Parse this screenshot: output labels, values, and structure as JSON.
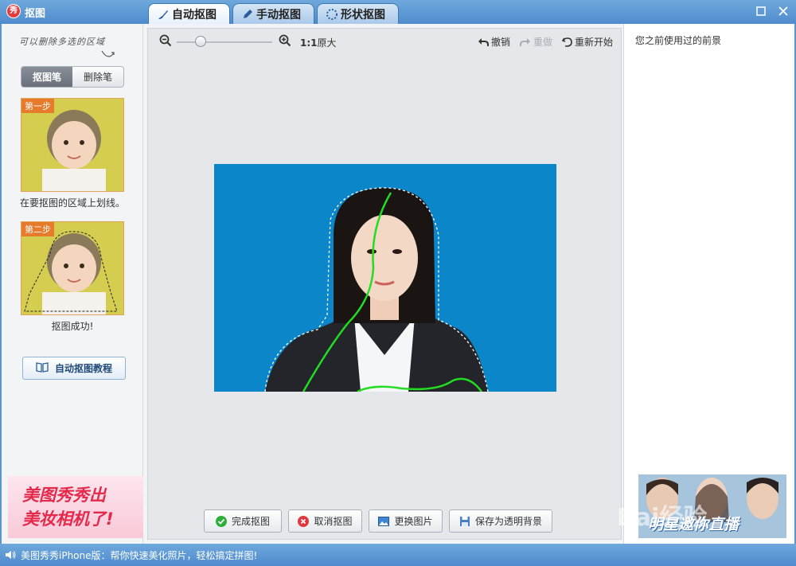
{
  "app": {
    "logo_text": "秀",
    "title": "抠图"
  },
  "tabs": [
    {
      "label": "自动抠图",
      "active": true
    },
    {
      "label": "手动抠图",
      "active": false
    },
    {
      "label": "形状抠图",
      "active": false
    }
  ],
  "left_panel": {
    "hint_text": "可以删除多选的区域",
    "tools": {
      "pen_label": "抠图笔",
      "eraser_label": "删除笔"
    },
    "step1": {
      "tag": "第一步",
      "caption": "在要抠图的区域上划线。"
    },
    "step2": {
      "tag": "第二步",
      "caption": "抠图成功!"
    },
    "tutorial_label": "自动抠图教程",
    "ad": {
      "line1": "美图秀秀出",
      "line2": "美妆相机了!"
    }
  },
  "toolbar": {
    "zoom_level": 0.25,
    "ratio_bold": "1:1",
    "ratio_label": "原大",
    "undo_label": "撤销",
    "redo_label": "重做",
    "restart_label": "重新开始"
  },
  "actions": {
    "finish_label": "完成抠图",
    "cancel_label": "取消抠图",
    "change_label": "更换图片",
    "save_label": "保存为透明背景"
  },
  "right_panel": {
    "title": "您之前使用过的前景",
    "ad_text": "明星邀你直播"
  },
  "statusbar": {
    "text": "美图秀秀iPhone版：帮你快速美化照片，轻松搞定拼图!"
  },
  "watermark": "Bai经验",
  "colors": {
    "titlebar": "#5b95cf",
    "photo_bg": "#0b86c8",
    "stroke": "#22dd22",
    "accent_orange": "#e57b2b"
  }
}
